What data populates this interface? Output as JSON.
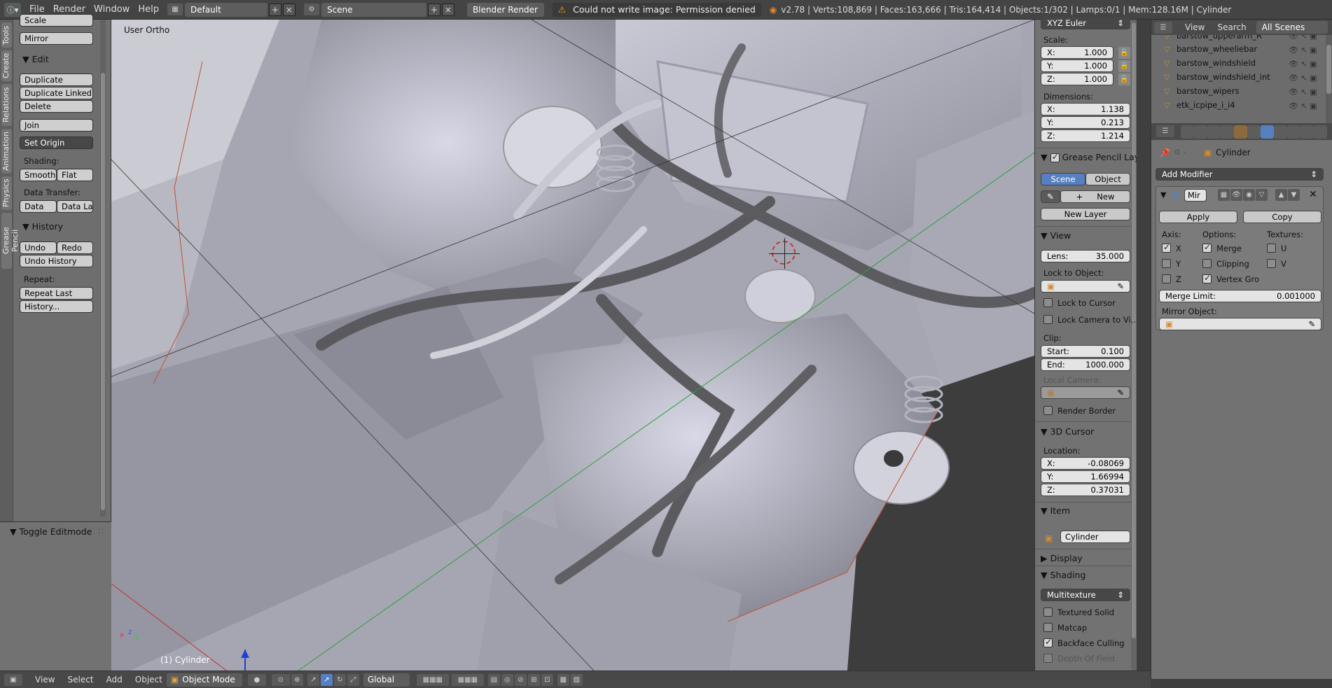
{
  "topbar": {
    "menus": [
      "File",
      "Render",
      "Window",
      "Help"
    ],
    "screen_layout": "Default",
    "scene": "Scene",
    "render_engine": "Blender Render",
    "warning": "Could not write image: Permission denied",
    "stats": "v2.78 | Verts:108,869 | Faces:163,666 | Tris:164,414 | Objects:1/302 | Lamps:0/1 | Mem:128.16M | Cylinder"
  },
  "toolshelf": {
    "tabs": [
      "Tools",
      "Create",
      "Relations",
      "Animation",
      "Physics",
      "Grease Pencil"
    ],
    "scale_label": "Scale",
    "mirror_label": "Mirror",
    "edit_header": "Edit",
    "duplicate": "Duplicate",
    "duplicate_linked": "Duplicate Linked",
    "delete": "Delete",
    "join": "Join",
    "set_origin": "Set Origin",
    "shading_label": "Shading:",
    "smooth": "Smooth",
    "flat": "Flat",
    "data_transfer_label": "Data Transfer:",
    "data": "Data",
    "data_la": "Data La",
    "history_header": "History",
    "undo": "Undo",
    "redo": "Redo",
    "undo_history": "Undo History",
    "repeat_label": "Repeat:",
    "repeat_last": "Repeat Last",
    "history_btn": "History...",
    "operator": "Toggle Editmode"
  },
  "viewport": {
    "view_name": "User Ortho",
    "active_object": "(1) Cylinder"
  },
  "npanel": {
    "rotation_mode": "XYZ Euler",
    "scale_label": "Scale:",
    "scale": {
      "x": "1.000",
      "y": "1.000",
      "z": "1.000"
    },
    "dimensions_label": "Dimensions:",
    "dimensions": {
      "x": "1.138",
      "y": "0.213",
      "z": "1.214"
    },
    "grease_pencil_header": "Grease Pencil Laye",
    "scene_tab": "Scene",
    "object_tab": "Object",
    "new_btn": "New",
    "new_layer": "New Layer",
    "view_header": "View",
    "lens_label": "Lens:",
    "lens": "35.000",
    "lock_to_object": "Lock to Object:",
    "lock_to_cursor": "Lock to Cursor",
    "lock_camera": "Lock Camera to Vi...",
    "clip_label": "Clip:",
    "clip_start_label": "Start:",
    "clip_start": "0.100",
    "clip_end_label": "End:",
    "clip_end": "1000.000",
    "local_camera": "Local Camera:",
    "render_border": "Render Border",
    "cursor_header": "3D Cursor",
    "location_label": "Location:",
    "cursor": {
      "x": "-0.08069",
      "y": "1.66994",
      "z": "0.37031"
    },
    "item_header": "Item",
    "item_name": "Cylinder",
    "display_header": "Display",
    "shading_header": "Shading",
    "shading_mode": "Multitexture",
    "textured_solid": "Textured Solid",
    "matcap": "Matcap",
    "backface_culling": "Backface Culling",
    "depth_of_field": "Depth Of Field"
  },
  "outliner": {
    "view": "View",
    "search": "Search",
    "scenes": "All Scenes",
    "rows": [
      "barstow_upperarm_R",
      "barstow_wheeliebar",
      "barstow_windshield",
      "barstow_windshield_int",
      "barstow_wipers",
      "etk_icpipe_i_i4"
    ]
  },
  "properties": {
    "object_name": "Cylinder",
    "add_modifier": "Add Modifier",
    "modifier_name": "Mir",
    "apply": "Apply",
    "copy": "Copy",
    "axis_label": "Axis:",
    "options_label": "Options:",
    "textures_label": "Textures:",
    "x": "X",
    "y": "Y",
    "z": "Z",
    "merge": "Merge",
    "clipping": "Clipping",
    "vertex_groups": "Vertex Gro",
    "u": "U",
    "v": "V",
    "merge_limit_label": "Merge Limit:",
    "merge_limit": "0.001000",
    "mirror_object": "Mirror Object:"
  },
  "bottombar": {
    "menus": [
      "View",
      "Select",
      "Add",
      "Object"
    ],
    "mode": "Object Mode",
    "orientation": "Global"
  }
}
